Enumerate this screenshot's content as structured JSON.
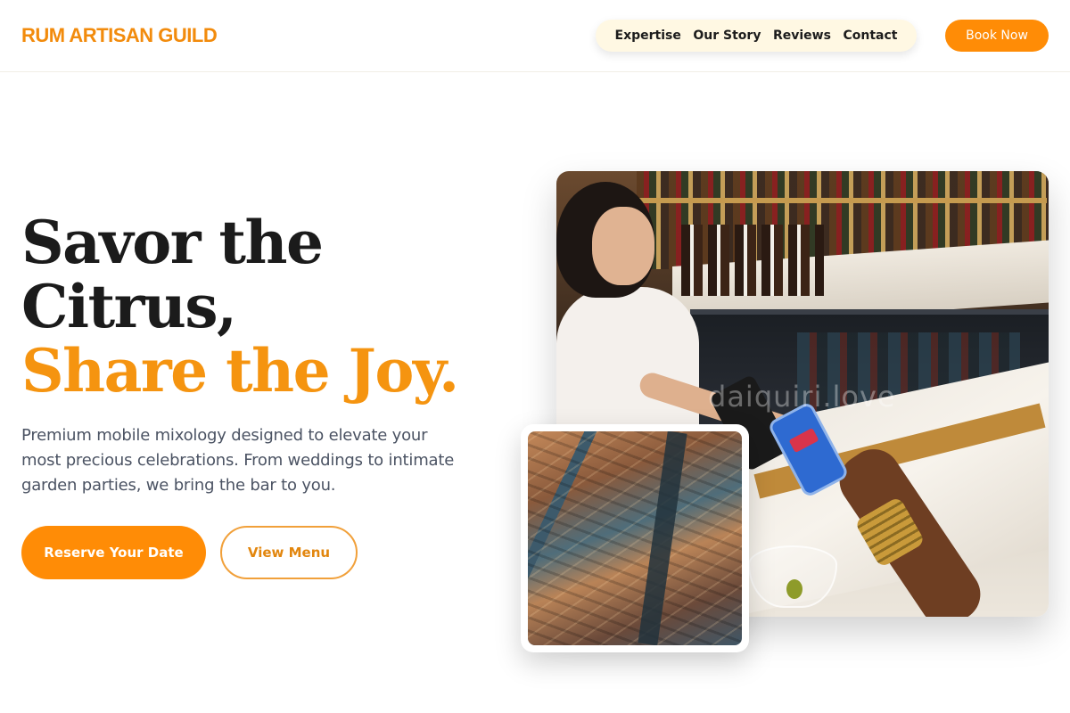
{
  "header": {
    "logo": "RUM ARTISAN GUILD",
    "nav": [
      {
        "label": "Expertise"
      },
      {
        "label": "Our Story"
      },
      {
        "label": "Reviews"
      },
      {
        "label": "Contact"
      }
    ],
    "cta": "Book Now"
  },
  "hero": {
    "headline_line1": "Savor the",
    "headline_line2": "Citrus,",
    "headline_accent": "Share the Joy.",
    "subtext": "Premium mobile mixology designed to elevate your most precious celebrations. From weddings to intimate garden parties, we bring the bar to you.",
    "primary_button": "Reserve Your Date",
    "secondary_button": "View Menu"
  },
  "media": {
    "watermark": "daiquiri.love"
  },
  "colors": {
    "accent": "#ff8c06",
    "accent_text": "#f59410",
    "nav_pill": "#fff8e3",
    "body_text": "#4b5363",
    "heading": "#1b1b1b"
  }
}
